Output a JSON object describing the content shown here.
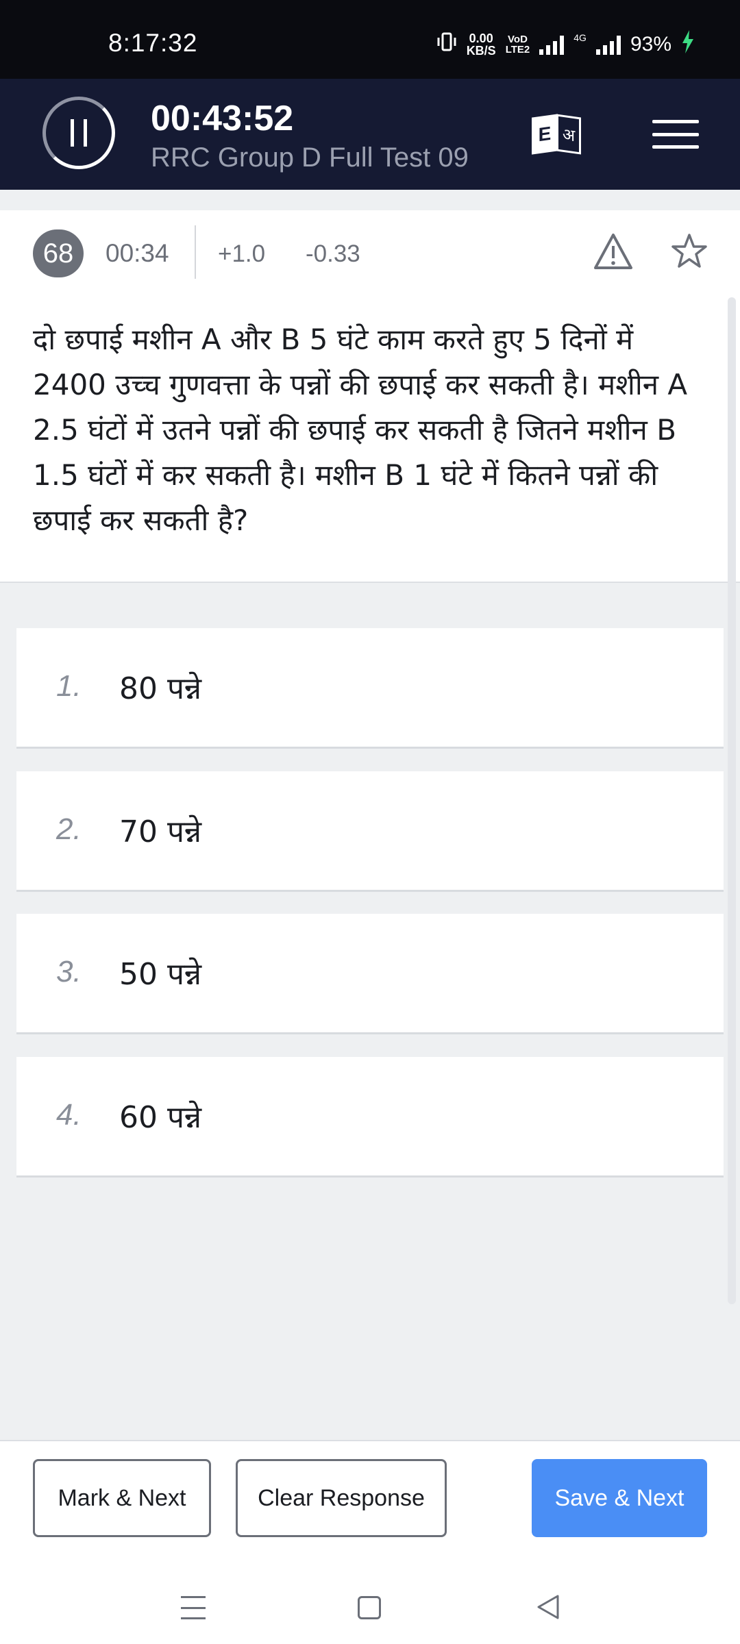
{
  "status_bar": {
    "time": "8:17:32",
    "speed_value": "0.00",
    "speed_unit": "KB/S",
    "volte_top": "VoD",
    "volte_bottom": "LTE2",
    "network": "4G",
    "battery": "93%",
    "battery_color": "#3ddc84"
  },
  "header": {
    "timer": "00:43:52",
    "test_title": "RRC Group D Full Test 09",
    "lang_en": "E",
    "lang_hi": "अ"
  },
  "meta": {
    "question_number": "68",
    "question_time": "00:34",
    "positive_mark": "+1.0",
    "negative_mark": "-0.33"
  },
  "question": {
    "text": "दो छपाई मशीन A और B 5 घंटे काम करते हुए 5 दिनों में 2400 उच्च गुणवत्ता के पन्नों की छपाई कर सकती है। मशीन A 2.5 घंटों में उतने पन्नों की छपाई कर सकती है जितने मशीन B 1.5 घंटों में कर सकती है। मशीन B 1 घंटे में कितने पन्नों की छपाई कर सकती है?"
  },
  "options": [
    {
      "num": "1.",
      "text": "80 पन्ने"
    },
    {
      "num": "2.",
      "text": "70 पन्ने"
    },
    {
      "num": "3.",
      "text": "50 पन्ने"
    },
    {
      "num": "4.",
      "text": "60 पन्ने"
    }
  ],
  "actions": {
    "mark_next": "Mark & Next",
    "clear_response": "Clear Response",
    "save_next": "Save & Next"
  },
  "colors": {
    "header_bg": "#151a33",
    "primary": "#4a8ef5"
  }
}
